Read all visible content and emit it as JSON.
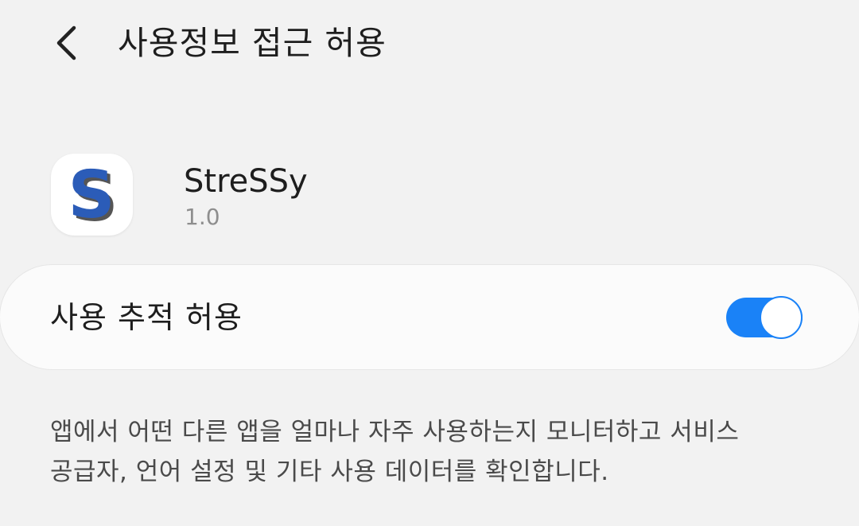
{
  "header": {
    "back_icon": "chevron-left-icon",
    "title": "사용정보 접근 허용"
  },
  "app": {
    "icon": "app-logo-s",
    "icon_letter": "S",
    "name": "StreSSy",
    "version": "1.0"
  },
  "setting": {
    "label": "사용 추적 허용",
    "toggle_on": true
  },
  "description": {
    "line1": "앱에서 어떤 다른 앱을 얼마나 자주 사용하는지 모니터하고 서비스",
    "line2": "공급자, 언어 설정 및 기타 사용 데이터를 확인합니다."
  },
  "colors": {
    "background": "#f2f2f2",
    "card": "#fbfbfb",
    "accent": "#1a82f7",
    "logo_blue": "#2b5cb8",
    "logo_shadow": "#555555"
  }
}
